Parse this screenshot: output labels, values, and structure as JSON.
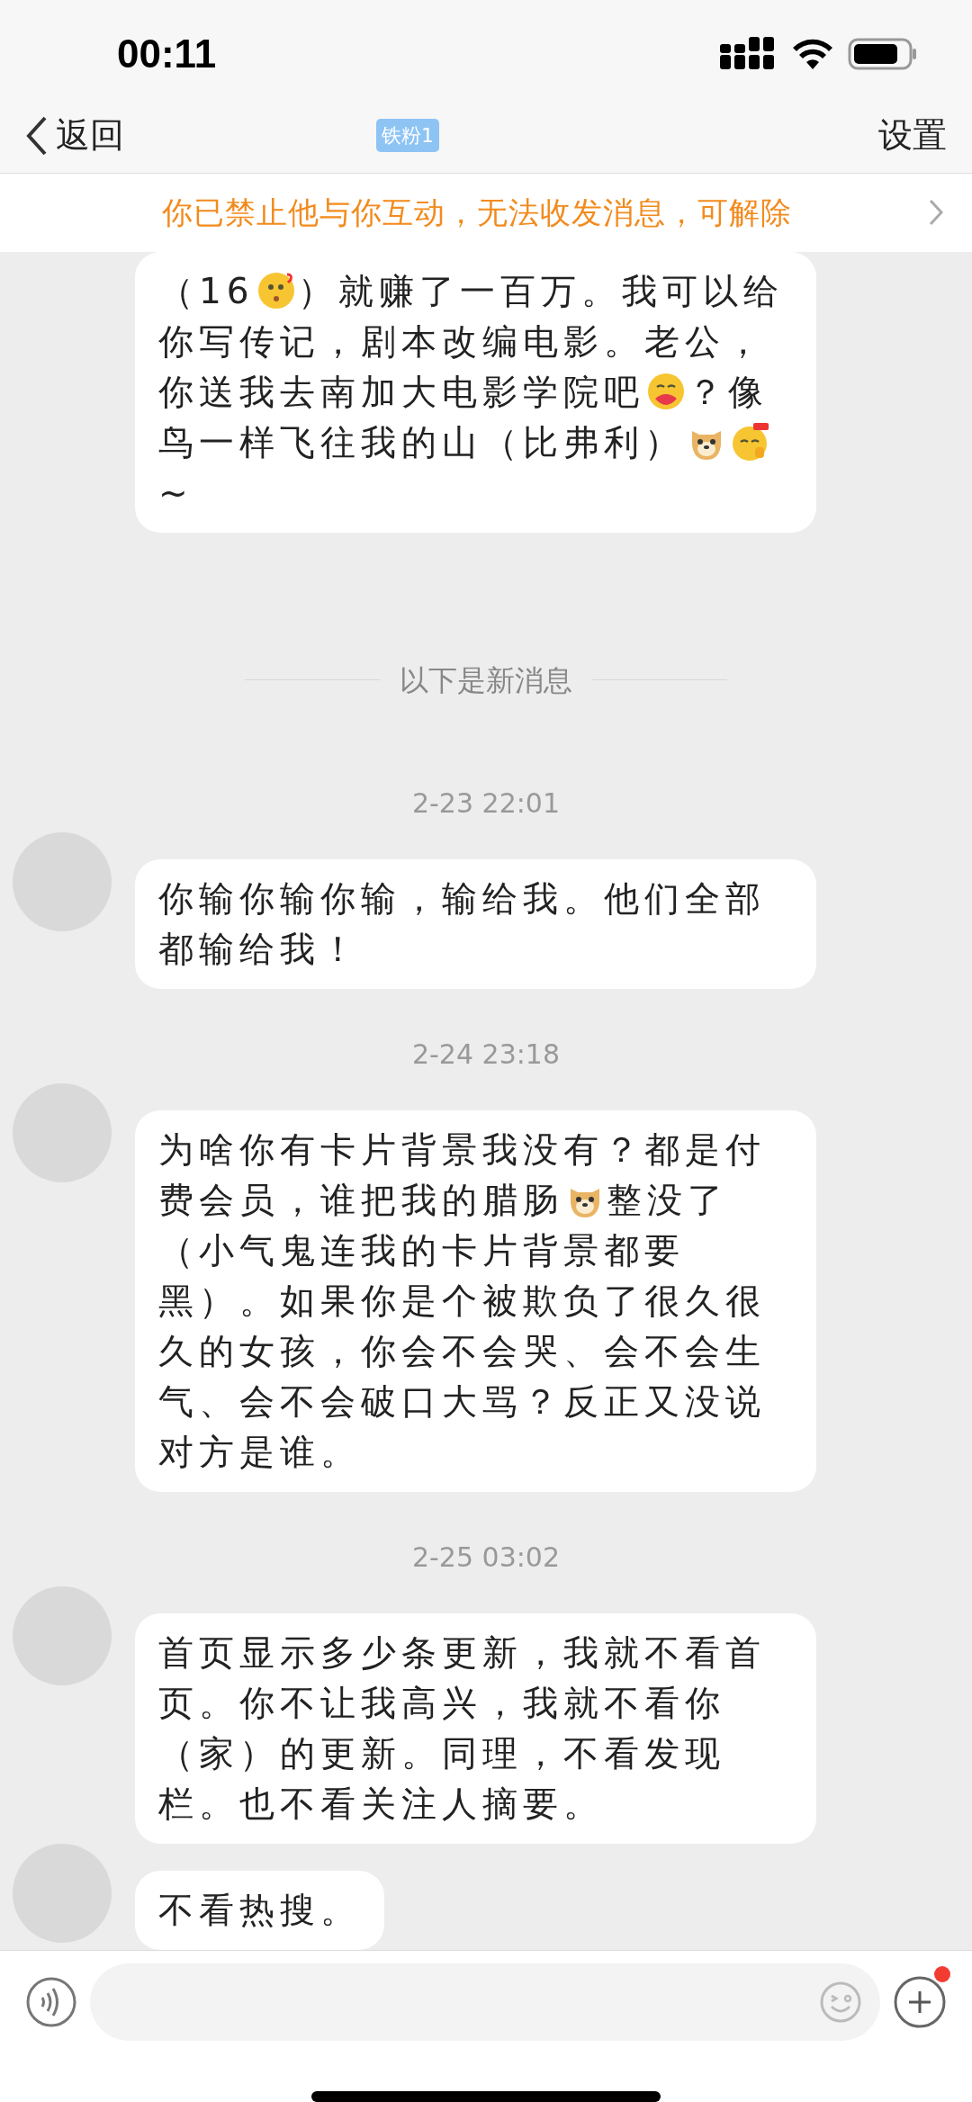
{
  "status_bar": {
    "time": "00:11"
  },
  "nav": {
    "back": "返回",
    "badge": "铁粉1",
    "settings": "设置"
  },
  "banner": {
    "text": "你已禁止他与你互动，无法收发消息，可解除"
  },
  "messages": [
    {
      "kind": "message",
      "avatar": false,
      "parts": [
        {
          "kind": "text",
          "text": "（16"
        },
        {
          "kind": "surprised"
        },
        {
          "kind": "text",
          "text": "）就赚了一百万。我可以给你写传记，剧本改编电影。老公，你送我去南加大电影学院吧"
        },
        {
          "kind": "hug"
        },
        {
          "kind": "text",
          "text": "？像鸟一样飞往我的山（比弗利）"
        },
        {
          "kind": "dog"
        },
        {
          "kind": "cheer"
        },
        {
          "kind": "text",
          "text": "~"
        }
      ]
    },
    {
      "kind": "divider",
      "text": "以下是新消息"
    },
    {
      "kind": "time",
      "text": "2-23 22:01"
    },
    {
      "kind": "message",
      "avatar": true,
      "parts": [
        {
          "kind": "text",
          "text": "你输你输你输，输给我。他们全部都输给我！"
        }
      ]
    },
    {
      "kind": "time",
      "text": "2-24 23:18"
    },
    {
      "kind": "message",
      "avatar": true,
      "parts": [
        {
          "kind": "text",
          "text": "为啥你有卡片背景我没有？都是付费会员，谁把我的腊肠"
        },
        {
          "kind": "dog"
        },
        {
          "kind": "text",
          "text": "整没了（小气鬼连我的卡片背景都要黑）。如果你是个被欺负了很久很久的女孩，你会不会哭、会不会生气、会不会破口大骂？反正又没说对方是谁。"
        }
      ]
    },
    {
      "kind": "time",
      "text": "2-25 03:02"
    },
    {
      "kind": "message",
      "avatar": true,
      "parts": [
        {
          "kind": "text",
          "text": "首页显示多少条更新，我就不看首页。你不让我高兴，我就不看你（家）的更新。同理，不看发现栏。也不看关注人摘要。"
        }
      ]
    },
    {
      "kind": "message",
      "avatar": true,
      "parts": [
        {
          "kind": "text",
          "text": "不看热搜。"
        }
      ]
    }
  ],
  "composer": {
    "notification": true
  }
}
